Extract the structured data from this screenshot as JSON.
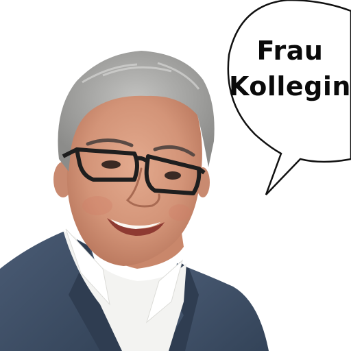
{
  "speech_bubble": {
    "line1": "Frau",
    "line2": "Kollegin"
  },
  "colors": {
    "background": "#ffffff",
    "bubble_fill": "#ffffff",
    "bubble_outline": "#111111",
    "text": "#0a0a0a",
    "jacket": "#3f5068",
    "shirt": "#f3f3f1",
    "skin": "#d79a80",
    "hair": "#a9a9a7"
  },
  "icons": [
    "speech-bubble-icon"
  ]
}
